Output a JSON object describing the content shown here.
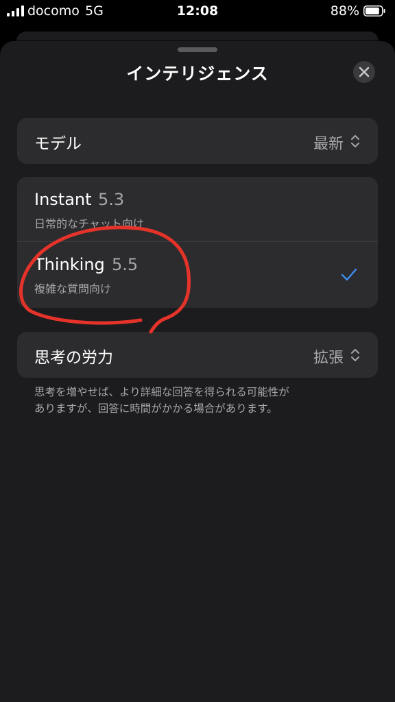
{
  "status_bar": {
    "carrier": "docomo",
    "network": "5G",
    "time": "12:08",
    "battery": "88%",
    "battery_level": 0.88
  },
  "sheet": {
    "title": "インテリジェンス",
    "close_icon": "close-icon"
  },
  "model_row": {
    "label": "モデル",
    "value": "最新",
    "icon": "chevron-up-down-icon"
  },
  "options": [
    {
      "title": "Instant",
      "version": "5.3",
      "subtitle": "日常的なチャット向け",
      "selected": false
    },
    {
      "title": "Thinking",
      "version": "5.5",
      "subtitle": "複雑な質問向け",
      "selected": true
    }
  ],
  "effort_row": {
    "label": "思考の労力",
    "value": "拡張",
    "icon": "chevron-up-down-icon"
  },
  "footnote": {
    "line1": "思考を増やせば、より詳細な回答を得られる可能性が",
    "line2": "ありますが、回答に時間がかかる場合があります。"
  },
  "colors": {
    "background": "#000000",
    "sheet": "#1c1c1e",
    "card": "#2c2c2e",
    "secondary_text": "#a7a7ac",
    "checkmark": "#3d8ff5",
    "annotation": "#e5332a"
  }
}
